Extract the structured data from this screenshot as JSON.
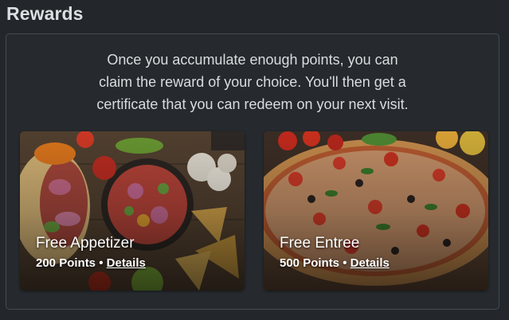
{
  "header": {
    "title": "Rewards"
  },
  "intro": {
    "line1": "Once you accumulate enough points, you can",
    "line2": "claim the reward of your choice. You'll then get a",
    "line3": "certificate that you can redeem on your next visit."
  },
  "rewards": [
    {
      "title": "Free Appetizer",
      "points": "200 Points",
      "separator": "•",
      "details_label": "Details",
      "image": "appetizer-platter"
    },
    {
      "title": "Free Entree",
      "points": "500 Points",
      "separator": "•",
      "details_label": "Details",
      "image": "pizza"
    }
  ],
  "colors": {
    "background": "#23272b",
    "panel_border": "#444a50",
    "text": "#d9dcdf"
  }
}
